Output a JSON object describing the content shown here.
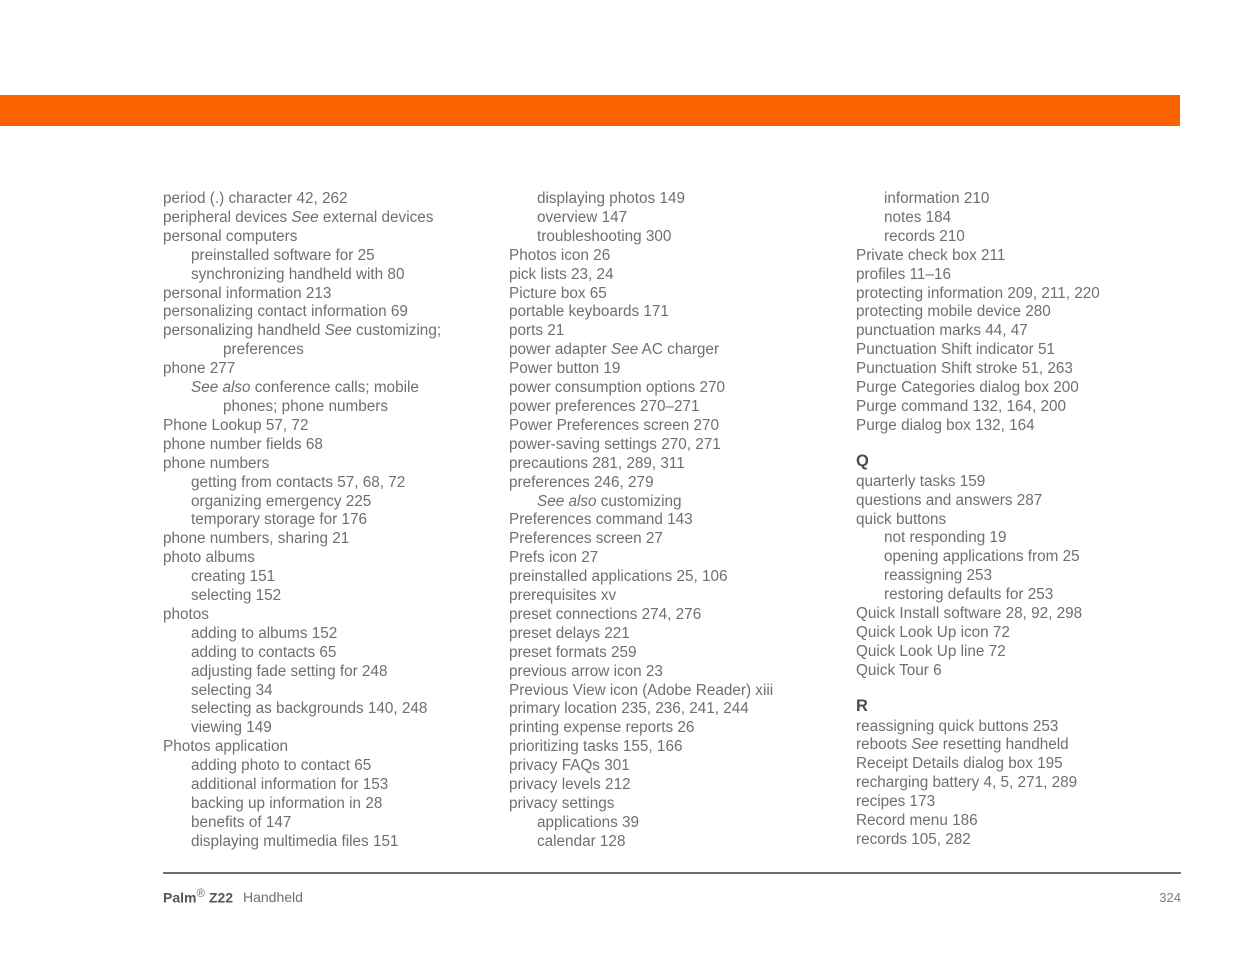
{
  "theme": {
    "accent_color": "#fa6400",
    "text_color": "#6f6f6f",
    "heading_color": "#4b4b4b",
    "rule_color": "#6f6f6f"
  },
  "footer": {
    "brand": "Palm",
    "registered_mark": "®",
    "model": "Z22",
    "product": "Handheld",
    "page_number": "324"
  },
  "columns": [
    {
      "id": "column-1",
      "entries": [
        {
          "level": 1,
          "text": "period (.) character 42, 262"
        },
        {
          "level": 1,
          "html": "peripheral devices <i>See</i> external devices"
        },
        {
          "level": 1,
          "text": "personal computers"
        },
        {
          "level": 2,
          "text": "preinstalled software for 25"
        },
        {
          "level": 2,
          "text": "synchronizing handheld with 80"
        },
        {
          "level": 1,
          "text": "personal information 213"
        },
        {
          "level": 1,
          "text": "personalizing contact information 69"
        },
        {
          "level": 1,
          "html": "personalizing handheld <i>See</i> customizing;"
        },
        {
          "level": 3,
          "text": "preferences"
        },
        {
          "level": 1,
          "text": "phone 277"
        },
        {
          "level": 2,
          "html": "<i>See also</i> conference calls; mobile"
        },
        {
          "level": 3,
          "text": "phones; phone numbers"
        },
        {
          "level": 1,
          "text": "Phone Lookup 57, 72"
        },
        {
          "level": 1,
          "text": "phone number fields 68"
        },
        {
          "level": 1,
          "text": "phone numbers"
        },
        {
          "level": 2,
          "text": "getting from contacts 57, 68, 72"
        },
        {
          "level": 2,
          "text": "organizing emergency 225"
        },
        {
          "level": 2,
          "text": "temporary storage for 176"
        },
        {
          "level": 1,
          "text": "phone numbers, sharing 21"
        },
        {
          "level": 1,
          "text": "photo albums"
        },
        {
          "level": 2,
          "text": "creating 151"
        },
        {
          "level": 2,
          "text": "selecting 152"
        },
        {
          "level": 1,
          "text": "photos"
        },
        {
          "level": 2,
          "text": "adding to albums 152"
        },
        {
          "level": 2,
          "text": "adding to contacts 65"
        },
        {
          "level": 2,
          "text": "adjusting fade setting for 248"
        },
        {
          "level": 2,
          "text": "selecting 34"
        },
        {
          "level": 2,
          "text": "selecting as backgrounds 140, 248"
        },
        {
          "level": 2,
          "text": "viewing 149"
        },
        {
          "level": 1,
          "text": "Photos application"
        },
        {
          "level": 2,
          "text": "adding photo to contact 65"
        },
        {
          "level": 2,
          "text": "additional information for 153"
        },
        {
          "level": 2,
          "text": "backing up information in 28"
        },
        {
          "level": 2,
          "text": "benefits of 147"
        },
        {
          "level": 2,
          "text": "displaying multimedia files 151"
        }
      ]
    },
    {
      "id": "column-2",
      "entries": [
        {
          "level": 2,
          "text": "displaying photos 149"
        },
        {
          "level": 2,
          "text": "overview 147"
        },
        {
          "level": 2,
          "text": "troubleshooting 300"
        },
        {
          "level": 1,
          "text": "Photos icon 26"
        },
        {
          "level": 1,
          "text": "pick lists 23, 24"
        },
        {
          "level": 1,
          "text": "Picture box 65"
        },
        {
          "level": 1,
          "text": "portable keyboards 171"
        },
        {
          "level": 1,
          "text": "ports 21"
        },
        {
          "level": 1,
          "html": "power adapter <i>See</i> AC charger"
        },
        {
          "level": 1,
          "text": "Power button 19"
        },
        {
          "level": 1,
          "text": "power consumption options 270"
        },
        {
          "level": 1,
          "text": "power preferences 270–271"
        },
        {
          "level": 1,
          "text": "Power Preferences screen 270"
        },
        {
          "level": 1,
          "text": "power-saving settings 270, 271"
        },
        {
          "level": 1,
          "text": "precautions 281, 289, 311"
        },
        {
          "level": 1,
          "text": "preferences 246, 279"
        },
        {
          "level": 2,
          "html": "<i>See also</i> customizing"
        },
        {
          "level": 1,
          "text": "Preferences command 143"
        },
        {
          "level": 1,
          "text": "Preferences screen 27"
        },
        {
          "level": 1,
          "text": "Prefs icon 27"
        },
        {
          "level": 1,
          "text": "preinstalled applications 25, 106"
        },
        {
          "level": 1,
          "text": "prerequisites xv"
        },
        {
          "level": 1,
          "text": "preset connections 274, 276"
        },
        {
          "level": 1,
          "text": "preset delays 221"
        },
        {
          "level": 1,
          "text": "preset formats 259"
        },
        {
          "level": 1,
          "text": "previous arrow icon 23"
        },
        {
          "level": 1,
          "text": "Previous View icon (Adobe Reader) xiii"
        },
        {
          "level": 1,
          "text": "primary location 235, 236, 241, 244"
        },
        {
          "level": 1,
          "text": "printing expense reports 26"
        },
        {
          "level": 1,
          "text": "prioritizing tasks 155, 166"
        },
        {
          "level": 1,
          "text": "privacy FAQs 301"
        },
        {
          "level": 1,
          "text": "privacy levels 212"
        },
        {
          "level": 1,
          "text": "privacy settings"
        },
        {
          "level": 2,
          "text": "applications 39"
        },
        {
          "level": 2,
          "text": "calendar 128"
        }
      ]
    },
    {
      "id": "column-3",
      "entries": [
        {
          "level": 2,
          "text": "information 210"
        },
        {
          "level": 2,
          "text": "notes 184"
        },
        {
          "level": 2,
          "text": "records 210"
        },
        {
          "level": 1,
          "text": "Private check box 211"
        },
        {
          "level": 1,
          "text": "profiles 11–16"
        },
        {
          "level": 1,
          "text": "protecting information 209, 211, 220"
        },
        {
          "level": 1,
          "text": "protecting mobile device 280"
        },
        {
          "level": 1,
          "text": "punctuation marks 44, 47"
        },
        {
          "level": 1,
          "text": "Punctuation Shift indicator 51"
        },
        {
          "level": 1,
          "text": "Punctuation Shift stroke 51, 263"
        },
        {
          "level": 1,
          "text": "Purge Categories dialog box 200"
        },
        {
          "level": 1,
          "text": "Purge command 132, 164, 200"
        },
        {
          "level": 1,
          "text": "Purge dialog box 132, 164"
        },
        {
          "letter": "Q"
        },
        {
          "level": 1,
          "text": "quarterly tasks 159"
        },
        {
          "level": 1,
          "text": "questions and answers 287"
        },
        {
          "level": 1,
          "text": "quick buttons"
        },
        {
          "level": 2,
          "text": "not responding 19"
        },
        {
          "level": 2,
          "text": "opening applications from 25"
        },
        {
          "level": 2,
          "text": "reassigning 253"
        },
        {
          "level": 2,
          "text": "restoring defaults for 253"
        },
        {
          "level": 1,
          "text": "Quick Install software 28, 92, 298"
        },
        {
          "level": 1,
          "text": "Quick Look Up icon 72"
        },
        {
          "level": 1,
          "text": "Quick Look Up line 72"
        },
        {
          "level": 1,
          "text": "Quick Tour 6"
        },
        {
          "letter": "R"
        },
        {
          "level": 1,
          "text": "reassigning quick buttons 253"
        },
        {
          "level": 1,
          "html": "reboots <i>See</i> resetting handheld"
        },
        {
          "level": 1,
          "text": "Receipt Details dialog box 195"
        },
        {
          "level": 1,
          "text": "recharging battery 4, 5, 271, 289"
        },
        {
          "level": 1,
          "text": "recipes 173"
        },
        {
          "level": 1,
          "text": "Record menu 186"
        },
        {
          "level": 1,
          "text": "records 105, 282"
        }
      ]
    }
  ]
}
